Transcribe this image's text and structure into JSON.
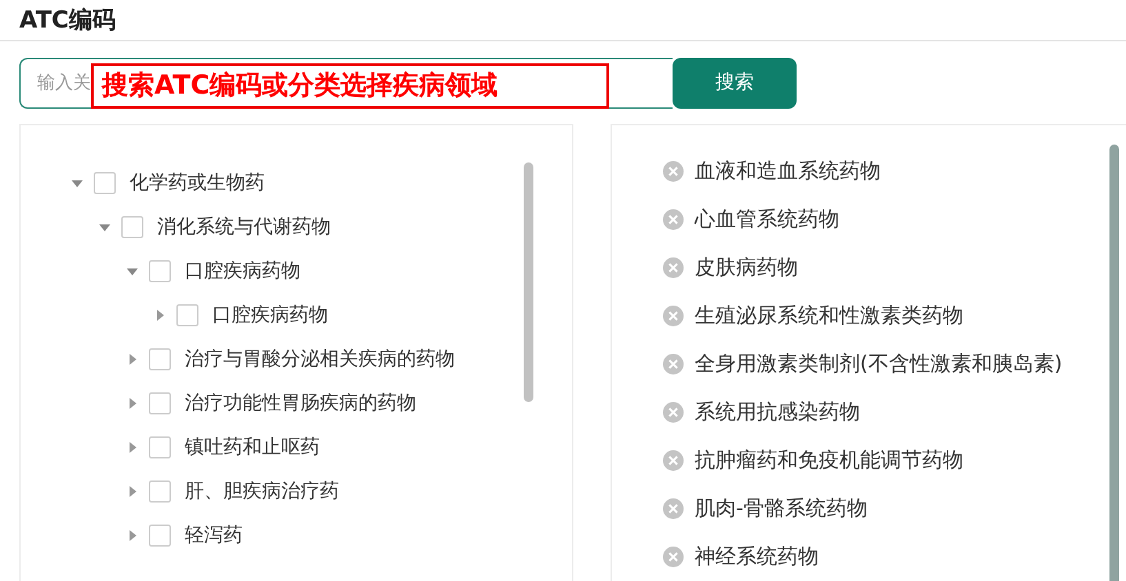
{
  "header": {
    "title": "ATC编码"
  },
  "search": {
    "placeholder": "输入关",
    "button": "搜索"
  },
  "annotation": {
    "text": "搜索ATC编码或分类选择疾病领域"
  },
  "tree": [
    {
      "label": "化学药或生物药",
      "checked": false,
      "expanded": true,
      "children": [
        {
          "label": "消化系统与代谢药物",
          "checked": false,
          "expanded": true,
          "children": [
            {
              "label": "口腔疾病药物",
              "checked": false,
              "expanded": true,
              "children": [
                {
                  "label": "口腔疾病药物",
                  "checked": false,
                  "expanded": false
                }
              ]
            },
            {
              "label": "治疗与胃酸分泌相关疾病的药物",
              "checked": false,
              "expanded": false
            },
            {
              "label": "治疗功能性胃肠疾病的药物",
              "checked": false,
              "expanded": false
            },
            {
              "label": "镇吐药和止呕药",
              "checked": false,
              "expanded": false
            },
            {
              "label": "肝、胆疾病治疗药",
              "checked": false,
              "expanded": false
            },
            {
              "label": "轻泻药",
              "checked": false,
              "expanded": false
            }
          ]
        }
      ]
    }
  ],
  "selected": [
    "血液和造血系统药物",
    "心血管系统药物",
    "皮肤病药物",
    "生殖泌尿系统和性激素类药物",
    "全身用激素类制剂(不含性激素和胰岛素)",
    "系统用抗感染药物",
    "抗肿瘤药和免疫机能调节药物",
    "肌肉-骨骼系统药物",
    "神经系统药物"
  ]
}
